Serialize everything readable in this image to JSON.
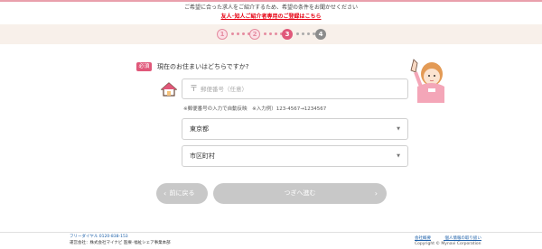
{
  "header": {
    "intro": "ご希望に合った求人をご紹介するため、希望の条件をお聞かせください",
    "referral_link": "友人･知人ご紹介者専用のご登録はこちら"
  },
  "steps": [
    "1",
    "2",
    "3",
    "4"
  ],
  "form": {
    "required_badge": "必須",
    "question": "現在のお住まいはどちらですか?",
    "zip_mark": "〒",
    "zip_placeholder": "郵便番号（任意）",
    "zip_note": "※郵便番号の入力で自動反映　※入力例）123-4567→1234567",
    "prefecture_value": "東京都",
    "city_value": "市区町村",
    "select_arrow": "▼"
  },
  "buttons": {
    "back": "前に戻る",
    "next": "つぎへ進む",
    "back_chevron": "‹",
    "next_chevron": "›"
  },
  "footer": {
    "free_dial": "フリーダイヤル 0120-838-153",
    "operator": "運営会社：株式会社マイナビ 医療･福祉シェア事業本部",
    "links": [
      "会社概要",
      "個人情報の取り扱い"
    ],
    "copyright": "Copyright © Mynavi Corporation"
  },
  "colors": {
    "accent_pink": "#e0587a",
    "step_bar_bg": "#f8f0ea",
    "button_disabled": "#c8c8c8",
    "link_blue": "#1a5ea8",
    "referral_red": "#e60012"
  }
}
